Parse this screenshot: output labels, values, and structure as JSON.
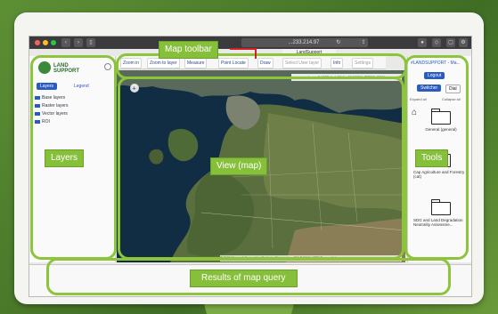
{
  "annotations": {
    "toolbar": "Map toolbar",
    "layers": "Layers",
    "view": "View (map)",
    "tools": "Tools",
    "results": "Results of map query"
  },
  "browser": {
    "url": "...233.214.97",
    "tab_title": "LandSupport"
  },
  "map_toolbar": {
    "zoom_in": "Zoom in",
    "zoom_to_layer": "Zoom to layer",
    "measure": "Measure",
    "point_locate": "Point Locate",
    "draw": "Draw",
    "select_user_layer": "Select User layer",
    "info": "Info",
    "settings": "Settings"
  },
  "coords": "Long: 0.4305; Lat: 51.1 • 09.58566 (EPSG:4326)",
  "attribution": "© 2018 Microsoft Corporation Earthstar Geographics SIO © 2018 HERE Terms of Use",
  "layers_panel": {
    "logo": "LAND SUPPORT",
    "tabs": [
      "Layers",
      "Legend"
    ],
    "items": [
      "Base layers",
      "Raster layers",
      "Vector layers",
      "ROI"
    ]
  },
  "tools_panel": {
    "header": "#LANDSUPPORT - Ma...",
    "logout": "Logout",
    "buttons": [
      "Switcher",
      "Dial"
    ],
    "expand": "Expand all",
    "collapse": "Collapse all",
    "folders": [
      "General (general)",
      "Cap Agriculture and Forestry (cat)",
      "SDG and Land Degradation Neutrality Assessme..."
    ]
  },
  "colors": {
    "highlight": "#8cc43c",
    "label_bg": "#86bf3a"
  }
}
